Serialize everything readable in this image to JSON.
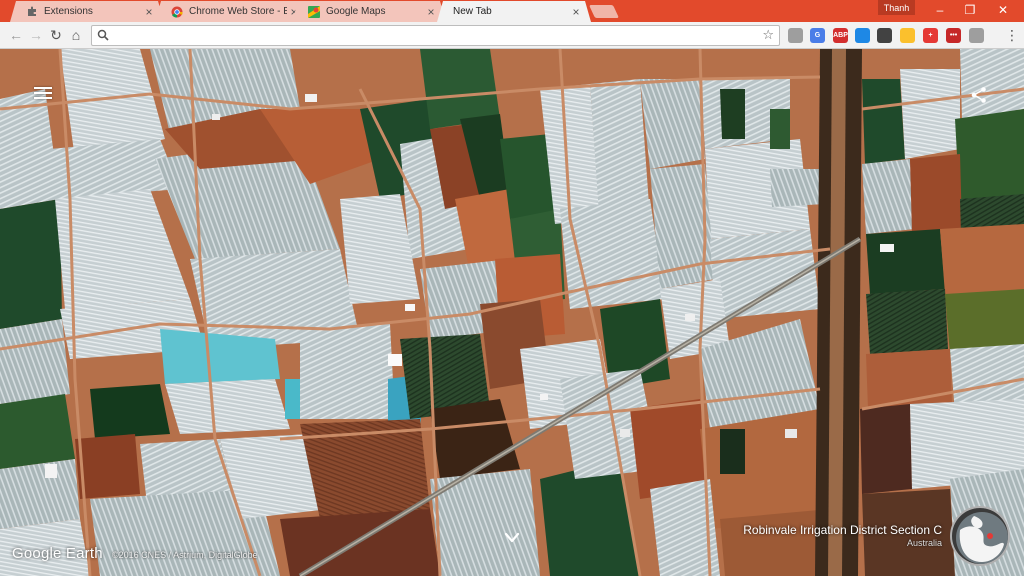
{
  "tabs": [
    {
      "title": "Extensions",
      "favicon": "puzzle-icon",
      "close": "×"
    },
    {
      "title": "Chrome Web Store - Eart",
      "favicon": "chrome-webstore-icon",
      "close": "×"
    },
    {
      "title": "Google Maps",
      "favicon": "maps-pin-icon",
      "close": "×"
    },
    {
      "title": "New Tab",
      "favicon": "",
      "close": "×",
      "active": true
    }
  ],
  "profile": {
    "name": "Thanh"
  },
  "window_controls": {
    "minimize": "–",
    "maximize": "❐",
    "close": "✕"
  },
  "toolbar": {
    "back": "←",
    "forward": "→",
    "reload": "↻",
    "home": "⌂",
    "omnibox_value": "",
    "bookmark_star": "☆",
    "menu": "⋮"
  },
  "extensions": [
    {
      "name": "extension-grey-icon",
      "color": "#9e9e9e",
      "label": ""
    },
    {
      "name": "translate-icon",
      "color": "#4a7de8",
      "label": "G"
    },
    {
      "name": "adblock-abp-icon",
      "color": "#d32f2f",
      "label": "ABP"
    },
    {
      "name": "blue-circle-icon",
      "color": "#1e88e5",
      "label": ""
    },
    {
      "name": "layers-icon",
      "color": "#424242",
      "label": ""
    },
    {
      "name": "yellow-ring-icon",
      "color": "#fbc02d",
      "label": ""
    },
    {
      "name": "red-plus-icon",
      "color": "#e53935",
      "label": "+"
    },
    {
      "name": "red-dots-icon",
      "color": "#c62828",
      "label": "•••"
    },
    {
      "name": "grey-box-icon",
      "color": "#9e9e9e",
      "label": ""
    }
  ],
  "map": {
    "logo": "Google Earth",
    "attribution": "©2016 CNES / Astrium, DigitalGlobe",
    "place_name": "Robinvale Irrigation District Section C",
    "place_country": "Australia"
  },
  "colors": {
    "titlebar": "#e24a2c",
    "tab_inactive": "#f3c5bb",
    "tab_active": "#f2f2f2"
  }
}
